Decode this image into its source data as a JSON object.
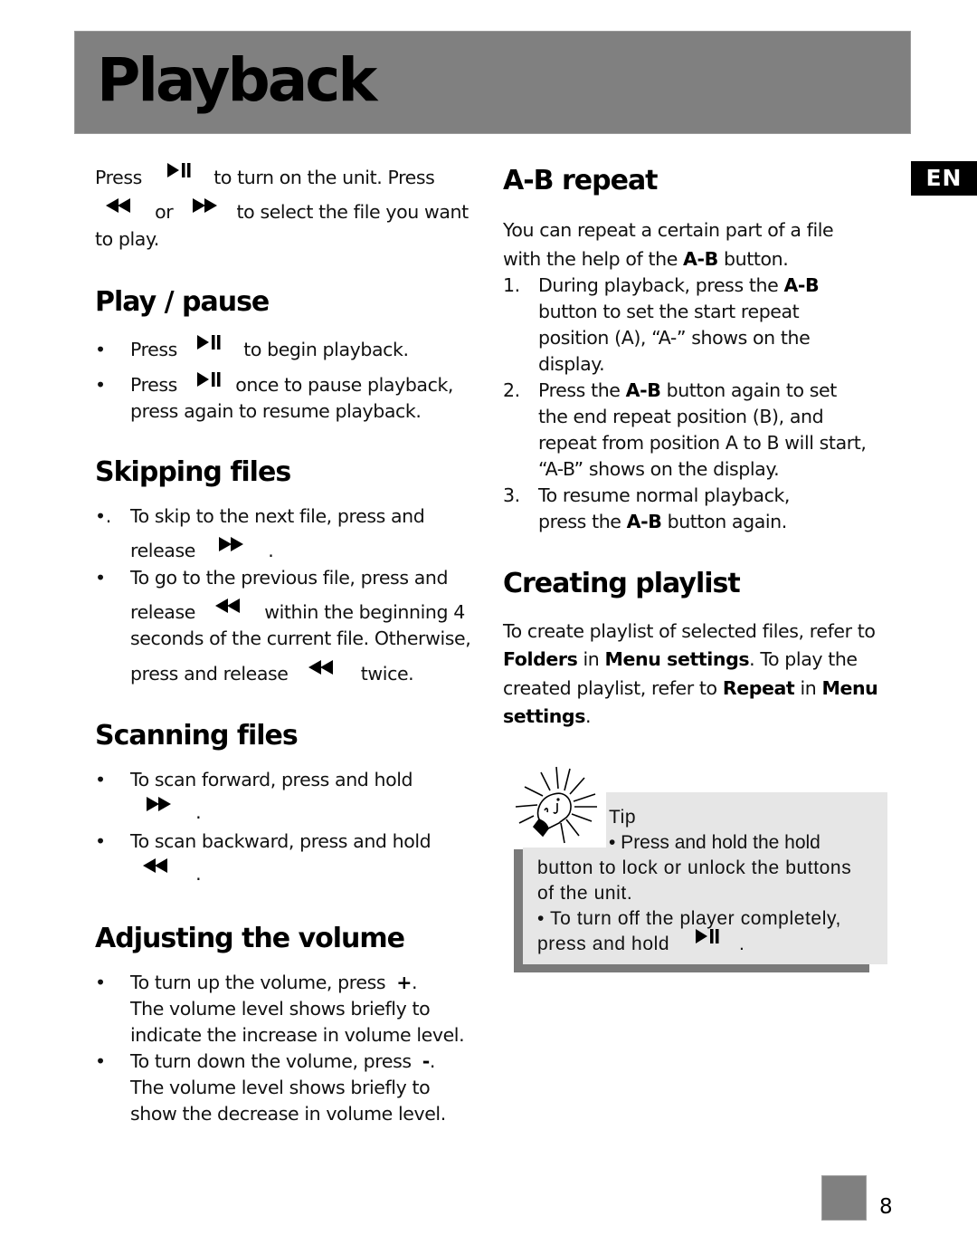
{
  "header": {
    "title": "Playback"
  },
  "language_tab": "EN",
  "intro": {
    "p1": "Press",
    "p2": "to turn on the unit. Press",
    "p3": "or",
    "p4": "to select the file you want",
    "p5": "to play.",
    "icons": [
      "play-pause-icon",
      "rewind-icon",
      "fast-forward-icon"
    ]
  },
  "play_pause": {
    "heading": "Play / pause",
    "items": [
      {
        "bullet": "•",
        "before": "Press",
        "after": "to begin playback.",
        "icon": "play-pause-icon"
      },
      {
        "bullet": "•",
        "before": "Press",
        "after": "once to pause playback,",
        "line2": "press again to resume playback.",
        "icon": "play-pause-icon"
      }
    ]
  },
  "skipping": {
    "heading": "Skipping files",
    "items": [
      {
        "bullet": "•.",
        "line1": "To skip to the next file, press and",
        "before": "release",
        "after": ".",
        "icon": "fast-forward-icon"
      },
      {
        "bullet": "•",
        "line1": "To go to the previous file, press and",
        "before": "release",
        "after": "within the beginning 4",
        "line3": "seconds of the current file. Otherwise,",
        "line4_before": "press and release",
        "line4_after": "twice.",
        "icon": "rewind-icon"
      }
    ]
  },
  "scanning": {
    "heading": "Scanning files",
    "items": [
      {
        "bullet": "•",
        "line1": "To scan forward, press and hold",
        "after": ".",
        "icon": "fast-forward-icon"
      },
      {
        "bullet": "•",
        "line1": "To scan backward, press and hold",
        "after": ".",
        "icon": "rewind-icon"
      }
    ]
  },
  "volume": {
    "heading": "Adjusting the volume",
    "items": [
      {
        "bullet": "•",
        "line1_before": "To turn up the volume, press",
        "key": "+",
        "line1_after": ".",
        "line2": "The volume level shows briefly to",
        "line3": "indicate the increase in volume level."
      },
      {
        "bullet": "•",
        "line1_before": "To turn down the volume, press",
        "key": "-",
        "line1_after": ".",
        "line2": "The volume level shows briefly to",
        "line3": "show the decrease in volume level."
      }
    ]
  },
  "ab_repeat": {
    "heading": "A-B repeat",
    "intro_line1": "You can repeat a certain part of a file",
    "intro_line2_before": "with the help of the",
    "intro_line2_bold": "A-B",
    "intro_line2_after": "button.",
    "steps": [
      {
        "num": "1.",
        "l1_before": "During playback, press the",
        "l1_bold": "A-B",
        "l2": "button to set the start repeat",
        "l3": "position (A), “A-” shows on the",
        "l4": "display."
      },
      {
        "num": "2.",
        "l1_before": "Press the",
        "l1_bold": "A-B",
        "l1_after": "button again to set",
        "l2": "the end repeat position (B), and",
        "l3": "repeat from position A to B will start,",
        "l4": "“A-B” shows on the display."
      },
      {
        "num": "3.",
        "l1": "To resume normal playback,",
        "l2_before": "press the",
        "l2_bold": "A-B",
        "l2_after": "button again."
      }
    ]
  },
  "playlist": {
    "heading": "Creating playlist",
    "l1": "To create playlist of selected files, refer to",
    "l2_b1": "Folders",
    "l2_t1": "in",
    "l2_b2": "Menu settings",
    "l2_t2": ". To play the",
    "l3_t1": "created playlist, refer to",
    "l3_b1": "Repeat",
    "l3_t2": "in",
    "l3_b2": "Menu",
    "l4_b1": "settings",
    "l4_t1": "."
  },
  "tip": {
    "title": "Tip",
    "l1": "• Press and hold the hold",
    "l2": "button to lock or unlock the buttons",
    "l3": "of the unit.",
    "l4": "• To turn off the player completely,",
    "l5_before": "press and hold",
    "l5_after": ".",
    "icon": "lightbulb-icon"
  },
  "footer": {
    "page_number": "8"
  }
}
